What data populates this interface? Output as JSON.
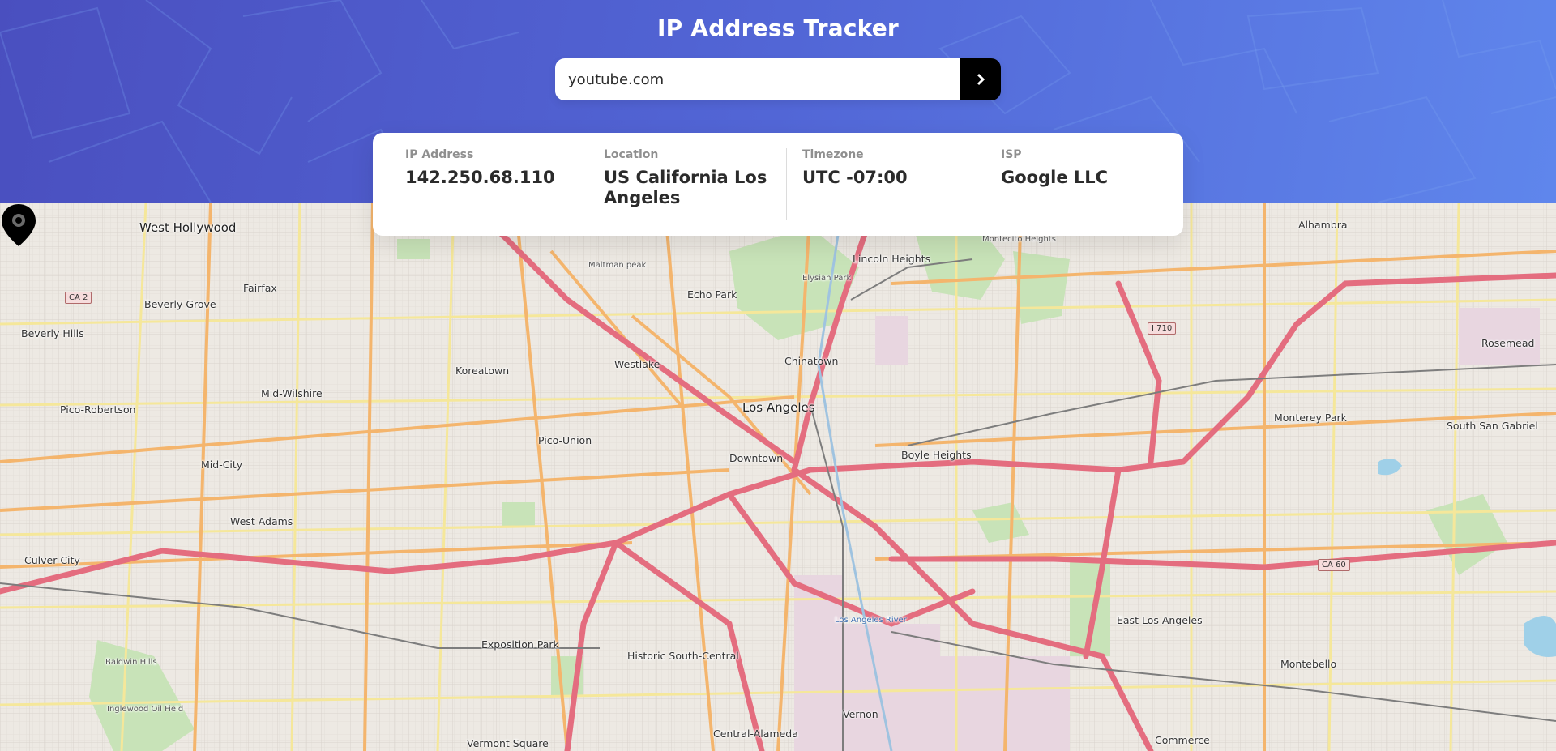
{
  "header": {
    "title": "IP Address Tracker"
  },
  "search": {
    "value": "youtube.com",
    "button_icon": "chevron-right-icon"
  },
  "info": {
    "items": [
      {
        "label": "IP Address",
        "value": "142.250.68.110"
      },
      {
        "label": "Location",
        "value": "US California Los Angeles"
      },
      {
        "label": "Timezone",
        "value": "UTC -07:00"
      },
      {
        "label": "ISP",
        "value": "Google LLC"
      }
    ]
  },
  "map": {
    "marker_icon": "location-pin-icon",
    "places": [
      "West Hollywood",
      "Fairfax",
      "Beverly Grove",
      "Beverly Hills",
      "Koreatown",
      "Mid-Wilshire",
      "Pico-Robertson",
      "Mid-City",
      "West Adams",
      "Culver City",
      "Westlake",
      "Echo Park",
      "Chinatown",
      "Los Angeles",
      "Pico-Union",
      "Downtown",
      "Boyle Heights",
      "Lincoln Heights",
      "Montecito Heights",
      "Alhambra",
      "Rosemead",
      "Monterey Park",
      "South San Gabriel",
      "East Los Angeles",
      "Montebello",
      "Commerce",
      "Vernon",
      "Central-Alameda",
      "Historic South-Central",
      "Exposition Park",
      "Vermont Square",
      "Inglewood Oil Field",
      "Baldwin Hills",
      "Maltman peak",
      "Elysian Park",
      "Los Angeles River"
    ],
    "shields": [
      "CA 2",
      "I 710",
      "CA 60"
    ]
  }
}
